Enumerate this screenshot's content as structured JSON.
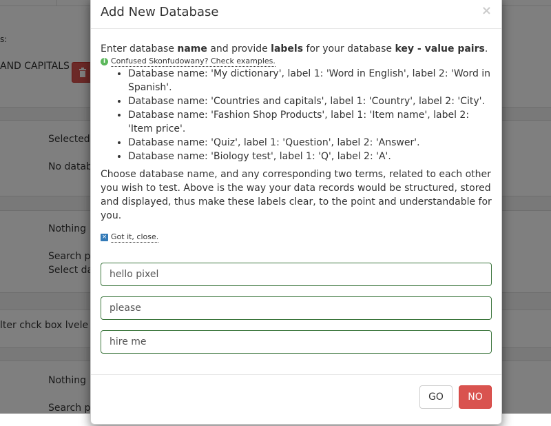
{
  "background": {
    "label_partial": "s:",
    "capital_text": "AND CAPITALS",
    "selected_text": "Selected",
    "no_database_text": "No datab",
    "nothing_text_1": "Nothing",
    "search_text_1": "Search p",
    "select_text": "Select da",
    "filter_text": "lter chck box lvele b",
    "nothing_text_2": "Nothing",
    "search_text_2": "Search p"
  },
  "modal": {
    "title": "Add New Database",
    "close_symbol": "×",
    "intro": {
      "part1": "Enter database ",
      "bold1": "name",
      "part2": " and provide ",
      "bold2": "labels",
      "part3": " for your database ",
      "bold3": "key - value pairs",
      "part4": "."
    },
    "hint_link": "Confused Skonfudowany? Check examples.",
    "examples": [
      "Database name: 'My dictionary', label 1: 'Word in English', label 2: 'Word in Spanish'.",
      "Database name: 'Countries and capitals', label 1: 'Country', label 2: 'City'.",
      "Database name: 'Fashion Shop Products', label 1: 'Item name', label 2: 'Item price'.",
      "Database name: 'Quiz', label 1: 'Question', label 2: 'Answer'.",
      "Database name: 'Biology test', label 1: 'Q', label 2: 'A'."
    ],
    "paragraph": "Choose database name, and any corresponding two terms, related to each other you wish to test. Above is the way your data records would be structured, stored and displayed, thus make these labels clear, to the point and understandable for you.",
    "gotit_link": "Got it, close.",
    "fields": {
      "name_value": "hello pixel",
      "label1_value": "please",
      "label2_value": "hire me"
    },
    "buttons": {
      "go": "GO",
      "no": "NO"
    }
  },
  "colors": {
    "danger": "#d9534f",
    "success_border": "#3c763d",
    "info_green": "#5cb85c",
    "link_blue": "#337ab7"
  }
}
